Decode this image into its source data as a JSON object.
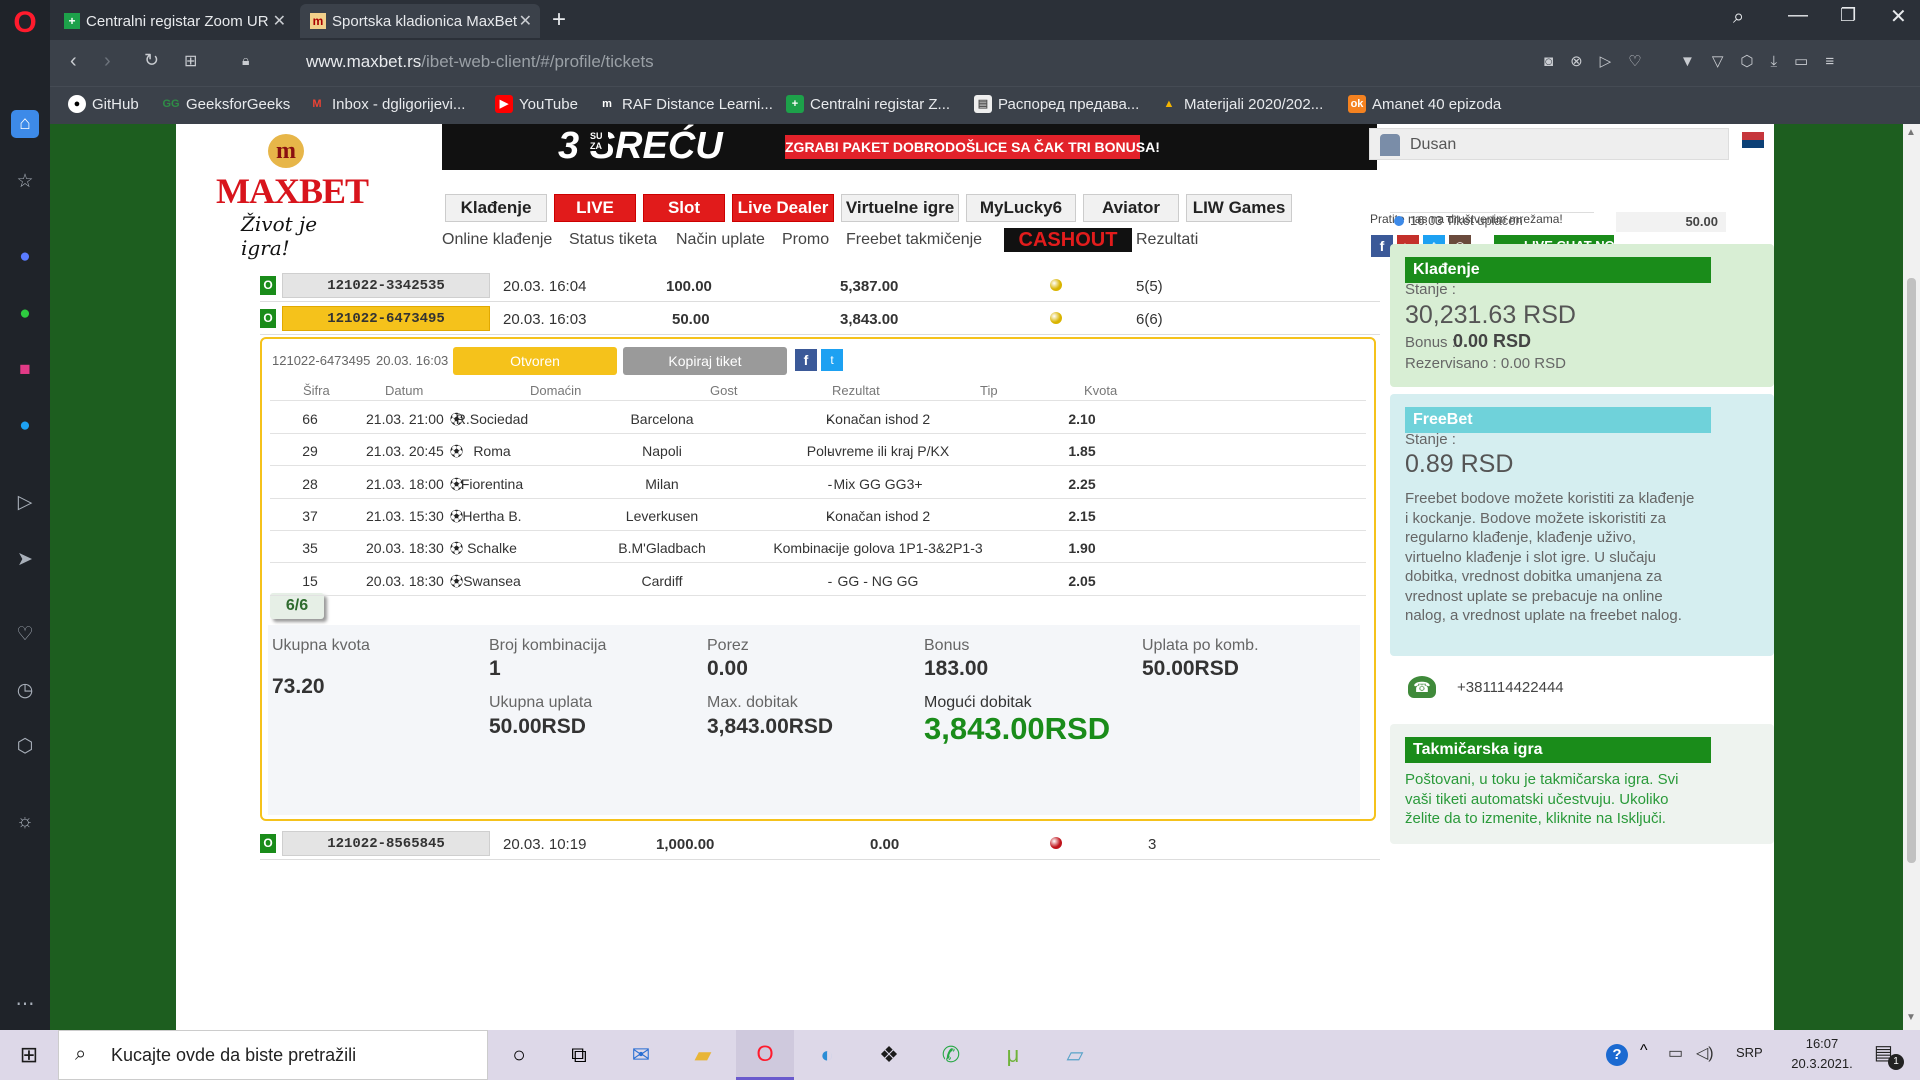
{
  "browser": {
    "tabs": [
      {
        "label": "Centralni registar Zoom UR",
        "active": false
      },
      {
        "label": "Sportska kladionica MaxBet",
        "active": true
      }
    ],
    "url_domain": "www.maxbet.rs",
    "url_path": "/ibet-web-client/#/profile/tickets",
    "bookmarks": [
      "GitHub",
      "GeeksforGeeks",
      "Inbox - dgligorijevi...",
      "YouTube",
      "RAF Distance Learni...",
      "Centralni registar Z...",
      "Распоред предава...",
      "Materijali 2020/202...",
      "Amanet 40 epizoda"
    ]
  },
  "header": {
    "logo_text": "MAXBET",
    "logo_tagline": "Život je igra!",
    "banner_left": "3 SREĆU",
    "banner_su_za": "SU ZA",
    "banner_right": "ZGRABI PAKET DOBRODOŠLICE SA ČAK TRI BONUSA!",
    "nav": [
      "Klađenje",
      "LIVE",
      "Slot",
      "Live Dealer",
      "Virtuelne igre",
      "MyLucky6",
      "Aviator",
      "LIW Games"
    ],
    "sub_nav": [
      "Online klađenje",
      "Status tiketa",
      "Način uplate",
      "Promo",
      "Freebet takmičenje",
      "CASHOUT",
      "Rezultati"
    ],
    "user_name": "Dusan",
    "social_text": "Pratite nas na društvenim mrežama!",
    "live_chat": "LIVE CHAT NOW"
  },
  "tickets": [
    {
      "status": "O",
      "id": "121022-3342535",
      "date": "20.03. 16:04",
      "stake": "100.00",
      "win": "5,387.00",
      "count": "5(5)",
      "dot_color": "#d9b400"
    },
    {
      "status": "O",
      "id": "121022-6473495",
      "date": "20.03. 16:03",
      "stake": "50.00",
      "win": "3,843.00",
      "count": "6(6)",
      "dot_color": "#d9b400"
    },
    {
      "status": "O",
      "id": "121022-8565845",
      "date": "20.03. 10:19",
      "stake": "1,000.00",
      "win": "0.00",
      "count": "3",
      "dot_color": "#c0141c"
    }
  ],
  "detail": {
    "id": "121022-6473495",
    "date": "20.03. 16:03",
    "btn_open": "Otvoren",
    "btn_copy": "Kopiraj tiket",
    "columns": [
      "Šifra",
      "Datum",
      "Domaćin",
      "Gost",
      "Rezultat",
      "Tip",
      "Kvota"
    ],
    "matches": [
      {
        "code": "66",
        "date": "21.03. 21:00",
        "home": "R.Sociedad",
        "away": "Barcelona",
        "result": "-",
        "tip": "Konačan ishod 2",
        "odd": "2.10"
      },
      {
        "code": "29",
        "date": "21.03. 20:45",
        "home": "Roma",
        "away": "Napoli",
        "result": "-",
        "tip": "Poluvreme ili kraj P/KX",
        "odd": "1.85"
      },
      {
        "code": "28",
        "date": "21.03. 18:00",
        "home": "Fiorentina",
        "away": "Milan",
        "result": "-",
        "tip": "Mix GG GG3+",
        "odd": "2.25"
      },
      {
        "code": "37",
        "date": "21.03. 15:30",
        "home": "Hertha B.",
        "away": "Leverkusen",
        "result": "-",
        "tip": "Konačan ishod 2",
        "odd": "2.15"
      },
      {
        "code": "35",
        "date": "20.03. 18:30",
        "home": "Schalke",
        "away": "B.M'Gladbach",
        "result": "-",
        "tip": "Kombinacije golova 1P1-3&2P1-3",
        "odd": "1.90"
      },
      {
        "code": "15",
        "date": "20.03. 18:30",
        "home": "Swansea",
        "away": "Cardiff",
        "result": "-",
        "tip": "GG - NG GG",
        "odd": "2.05"
      }
    ],
    "system": "6/6",
    "summary": {
      "total_odd_label": "Ukupna kvota",
      "total_odd": "73.20",
      "combinations_label": "Broj kombinacija",
      "combinations": "1",
      "tax_label": "Porez",
      "tax": "0.00",
      "bonus_label": "Bonus",
      "bonus": "183.00",
      "stake_per_label": "Uplata po komb.",
      "stake_per": "50.00RSD",
      "total_stake_label": "Ukupna uplata",
      "total_stake": "50.00RSD",
      "max_win_label": "Max. dobitak",
      "max_win": "3,843.00RSD",
      "possible_win_label": "Mogući dobitak",
      "possible_win": "3,843.00RSD"
    }
  },
  "right_panel": {
    "last_tx_text": "16:03 Tiket uplaćen",
    "last_tx_amount": "50.00",
    "betting": {
      "title": "Klađenje",
      "stanje_label": "Stanje :",
      "balance": "30,231.63 RSD",
      "bonus_label": "Bonus :",
      "bonus": "0.00 RSD",
      "reserved": "Rezervisano : 0.00 RSD"
    },
    "freebet": {
      "title": "FreeBet",
      "stanje_label": "Stanje :",
      "balance": "0.89 RSD",
      "text": "Freebet bodove možete koristiti za klađenje i kockanje. Bodove možete iskoristiti za regularno klađenje, klađenje uživo, virtuelno klađenje i slot igre. U slučaju dobitka, vrednost dobitka umanjena za vrednost uplate se prebacuje na online nalog, a vrednost uplate na freebet nalog."
    },
    "phone": "+381114422444",
    "competition": {
      "title": "Takmičarska igra",
      "text": "Poštovani, u toku je takmičarska igra. Svi vaši tiketi automatski učestvuju. Ukoliko želite da to izmenite, kliknite na Isključi."
    }
  },
  "taskbar": {
    "search_placeholder": "Kucajte ovde da biste pretražili",
    "lang": "SRP",
    "time": "16:07",
    "date": "20.3.2021.",
    "notifications": "1"
  }
}
